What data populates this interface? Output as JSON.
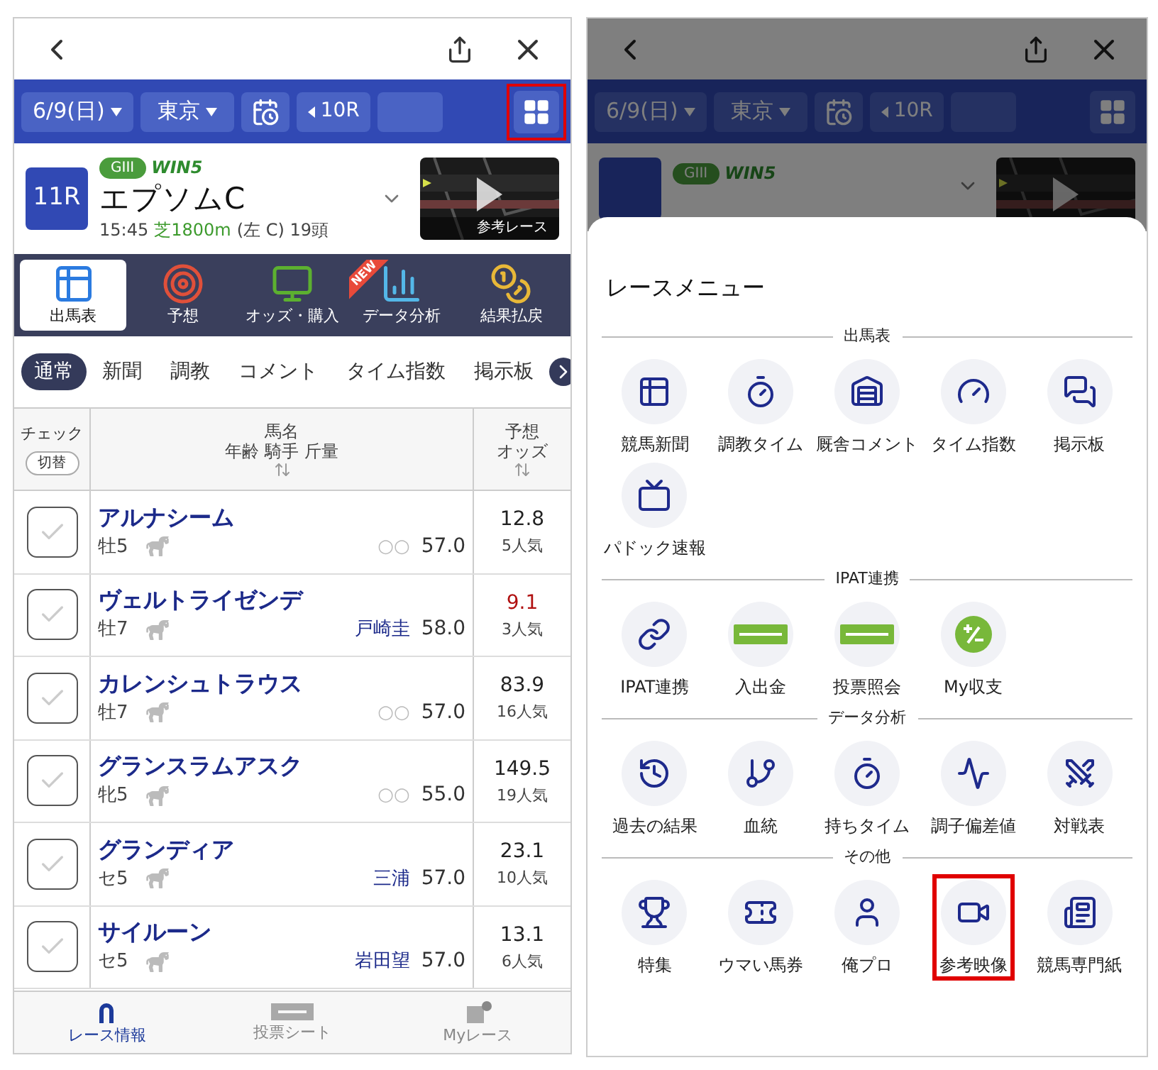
{
  "left_screen": {
    "toolbar": {
      "date": "6/9(日)",
      "venue": "東京",
      "prev_race": "10R",
      "menu_highlighted": true
    },
    "race": {
      "number": "11R",
      "grade": "GIII",
      "win5": "WIN5",
      "name": "エプソムC",
      "time": "15:45",
      "course": "芝1800m",
      "details": "(左 C) 19頭",
      "video_caption": "参考レース"
    },
    "main_tabs": [
      {
        "label": "出馬表",
        "selected": true
      },
      {
        "label": "予想",
        "selected": false
      },
      {
        "label": "オッズ・購入",
        "selected": false
      },
      {
        "label": "データ分析",
        "selected": false,
        "badge": "NEW"
      },
      {
        "label": "結果払戻",
        "selected": false
      }
    ],
    "sub_tabs": [
      {
        "label": "通常",
        "selected": true
      },
      {
        "label": "新聞",
        "selected": false
      },
      {
        "label": "調教",
        "selected": false
      },
      {
        "label": "コメント",
        "selected": false
      },
      {
        "label": "タイム指数",
        "selected": false
      },
      {
        "label": "掲示板",
        "selected": false
      }
    ],
    "table": {
      "columns": [
        {
          "label": "チェック",
          "button": "切替"
        },
        {
          "label": "馬名",
          "sublabel": "年齢 騎手 斤量"
        },
        {
          "label": "予想",
          "sublabel": "オッズ"
        }
      ],
      "rows": [
        {
          "name": "アルナシーム",
          "sex_age": "牡5",
          "jockey": "○○",
          "jockey_linked": false,
          "weight": "57.0",
          "odds": "12.8",
          "odds_highlight": false,
          "popularity": "5人気",
          "checked": false
        },
        {
          "name": "ヴェルトライゼンデ",
          "sex_age": "牡7",
          "jockey": "戸崎圭",
          "jockey_linked": true,
          "weight": "58.0",
          "odds": "9.1",
          "odds_highlight": true,
          "popularity": "3人気",
          "checked": false
        },
        {
          "name": "カレンシュトラウス",
          "sex_age": "牡7",
          "jockey": "○○",
          "jockey_linked": false,
          "weight": "57.0",
          "odds": "83.9",
          "odds_highlight": false,
          "popularity": "16人気",
          "checked": false
        },
        {
          "name": "グランスラムアスク",
          "sex_age": "牝5",
          "jockey": "○○",
          "jockey_linked": false,
          "weight": "55.0",
          "odds": "149.5",
          "odds_highlight": false,
          "popularity": "19人気",
          "checked": false
        },
        {
          "name": "グランディア",
          "sex_age": "セ5",
          "jockey": "三浦",
          "jockey_linked": true,
          "weight": "57.0",
          "odds": "23.1",
          "odds_highlight": false,
          "popularity": "10人気",
          "checked": false
        },
        {
          "name": "サイルーン",
          "sex_age": "セ5",
          "jockey": "岩田望",
          "jockey_linked": true,
          "weight": "57.0",
          "odds": "13.1",
          "odds_highlight": false,
          "popularity": "6人気",
          "checked": false
        }
      ]
    },
    "bottom_nav": [
      {
        "label": "レース情報",
        "selected": true
      },
      {
        "label": "投票シート",
        "selected": false
      },
      {
        "label": "Myレース",
        "selected": false
      }
    ]
  },
  "right_screen": {
    "toolbar": {
      "date": "6/9(日)",
      "venue": "東京",
      "prev_race": "10R"
    },
    "race": {
      "grade": "GIII",
      "win5": "WIN5"
    },
    "menu": {
      "title": "レースメニュー",
      "sections": [
        {
          "title": "出馬表",
          "items": [
            {
              "label": "競馬新聞",
              "highlighted": false
            },
            {
              "label": "調教タイム",
              "highlighted": false
            },
            {
              "label": "厩舎コメント",
              "highlighted": false
            },
            {
              "label": "タイム指数",
              "highlighted": false
            },
            {
              "label": "掲示板",
              "highlighted": false
            },
            {
              "label": "パドック速報",
              "highlighted": false
            }
          ]
        },
        {
          "title": "IPAT連携",
          "items": [
            {
              "label": "IPAT連携",
              "highlighted": false
            },
            {
              "label": "入出金",
              "highlighted": false
            },
            {
              "label": "投票照会",
              "highlighted": false
            },
            {
              "label": "My収支",
              "highlighted": false
            }
          ]
        },
        {
          "title": "データ分析",
          "items": [
            {
              "label": "過去の結果",
              "highlighted": false
            },
            {
              "label": "血統",
              "highlighted": false
            },
            {
              "label": "持ちタイム",
              "highlighted": false
            },
            {
              "label": "調子偏差値",
              "highlighted": false
            },
            {
              "label": "対戦表",
              "highlighted": false
            }
          ]
        },
        {
          "title": "その他",
          "items": [
            {
              "label": "特集",
              "highlighted": false
            },
            {
              "label": "ウマい馬券",
              "highlighted": false
            },
            {
              "label": "俺プロ",
              "highlighted": false
            },
            {
              "label": "参考映像",
              "highlighted": true
            },
            {
              "label": "競馬専門紙",
              "highlighted": false
            }
          ]
        }
      ]
    }
  }
}
